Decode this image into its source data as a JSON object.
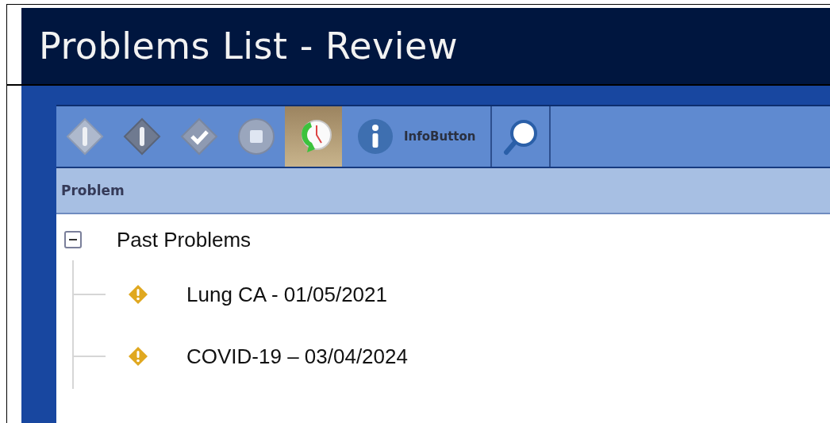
{
  "window": {
    "title": "Problems List - Review"
  },
  "toolbar": [
    {
      "kind": "diamond-alert",
      "selected": false
    },
    {
      "kind": "diamond-alert-dark",
      "selected": false
    },
    {
      "kind": "diamond-check",
      "selected": false
    },
    {
      "kind": "circle-stop",
      "selected": false
    },
    {
      "kind": "clock-arrow",
      "selected": true
    },
    {
      "kind": "info",
      "label": "InfoButton",
      "selected": false
    },
    {
      "kind": "search",
      "selected": false
    }
  ],
  "table": {
    "columns": [
      "Problem"
    ]
  },
  "tree": [
    {
      "label": "Past Problems",
      "expanded": true,
      "children": [
        {
          "label": "Lung CA - 01/05/2021"
        },
        {
          "label": "COVID-19 – 03/04/2024"
        }
      ]
    }
  ]
}
